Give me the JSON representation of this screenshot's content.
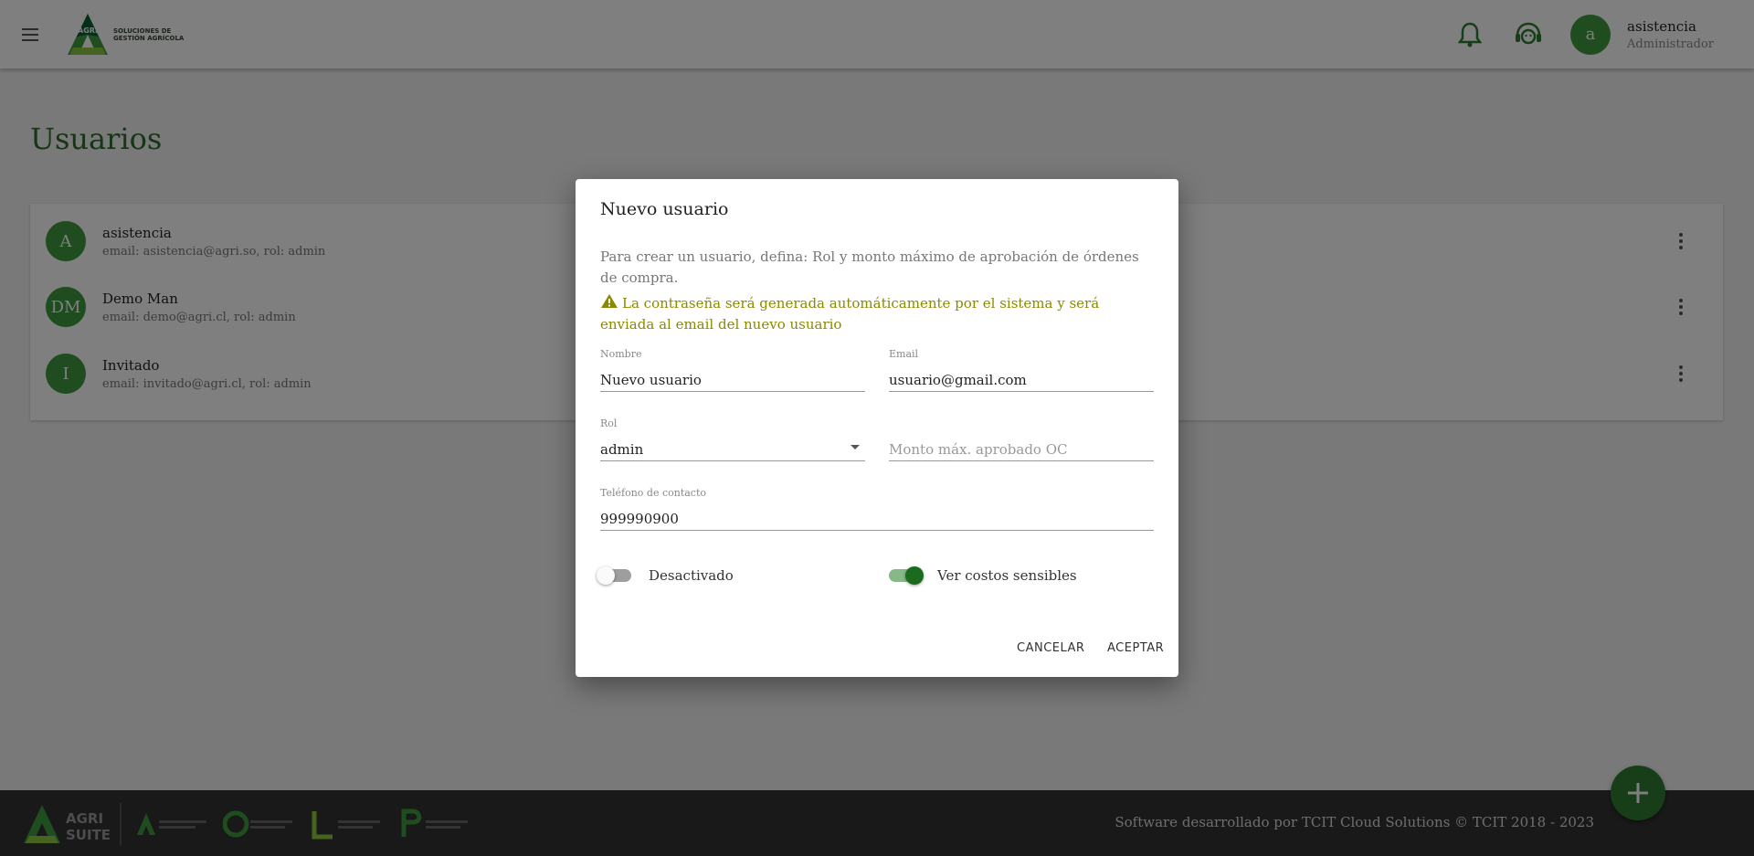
{
  "header": {
    "logo_text_line1": "SOLUCIONES DE",
    "logo_text_line2": "GESTIÓN AGRÍCOLA",
    "logo_mark_text": "AGRI",
    "user": {
      "initial": "a",
      "name": "asistencia",
      "role": "Administrador"
    }
  },
  "page": {
    "title": "Usuarios"
  },
  "users": [
    {
      "initial": "A",
      "name": "asistencia",
      "sub": "email: asistencia@agri.so, rol: admin"
    },
    {
      "initial": "DM",
      "name": "Demo Man",
      "sub": "email: demo@agri.cl, rol: admin"
    },
    {
      "initial": "I",
      "name": "Invitado",
      "sub": "email: invitado@agri.cl, rol: admin"
    }
  ],
  "footer": {
    "text": "Software desarrollado por TCIT Cloud Solutions © TCIT 2018 - 2023",
    "logo_main": [
      "AGRI",
      "SUITE"
    ]
  },
  "dialog": {
    "title": "Nuevo usuario",
    "info": "Para crear un usuario, defina: Rol y monto máximo de aprobación de órdenes de compra.",
    "warning": "La contraseña será generada automáticamente por el sistema y será enviada al email del nuevo usuario",
    "fields": {
      "nombre": {
        "label": "Nombre",
        "value": "Nuevo usuario"
      },
      "email": {
        "label": "Email",
        "value": "usuario@gmail.com"
      },
      "rol": {
        "label": "Rol",
        "value": "admin"
      },
      "monto": {
        "placeholder": "Monto máx. aprobado OC"
      },
      "telefono": {
        "label": "Teléfono de contacto",
        "value": "999990900"
      }
    },
    "toggles": {
      "activo": {
        "label": "Desactivado",
        "on": false
      },
      "costos": {
        "label": "Ver costos sensibles",
        "on": true
      }
    },
    "cancel_label": "CANCELAR",
    "accept_label": "ACEPTAR"
  },
  "colors": {
    "primary": "#2e7d32",
    "avatar": "#3f9a3f",
    "warning": "#8a8a00",
    "footer": "#333333"
  }
}
